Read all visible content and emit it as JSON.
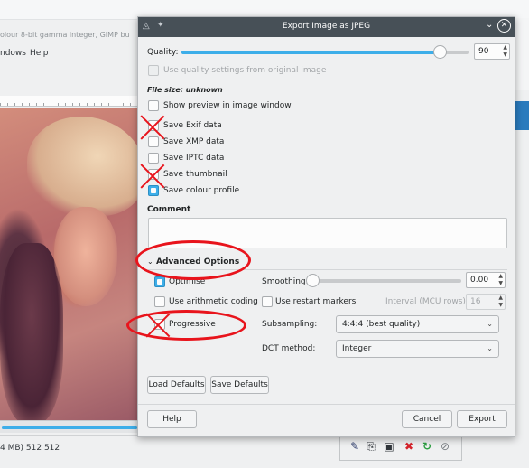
{
  "background_window": {
    "title_fragment": "olour 8-bit gamma integer, GIMP bu",
    "menu_windows": "ndows",
    "menu_help": "Help",
    "status_text": "4 MB) 512 512"
  },
  "dialog": {
    "title": "Export Image as JPEG",
    "quality": {
      "label": "Quality:",
      "value": "90",
      "fraction": 0.9
    },
    "use_original_quality": {
      "label": "Use quality settings from original image",
      "checked": false,
      "enabled": false
    },
    "file_size": "File size: unknown",
    "options": [
      {
        "key": "show_preview",
        "label": "Show preview in image window",
        "checked": false
      },
      {
        "key": "save_exif",
        "label": "Save Exif data",
        "checked": false
      },
      {
        "key": "save_xmp",
        "label": "Save XMP data",
        "checked": false
      },
      {
        "key": "save_iptc",
        "label": "Save IPTC data",
        "checked": false
      },
      {
        "key": "save_thumbnail",
        "label": "Save thumbnail",
        "checked": false
      },
      {
        "key": "save_colour_profile",
        "label": "Save colour profile",
        "checked": true
      }
    ],
    "comment_label": "Comment",
    "comment_value": "",
    "advanced": {
      "label": "Advanced Options",
      "expanded": true,
      "optimise": {
        "label": "Optimise",
        "checked": true
      },
      "arithmetic": {
        "label": "Use arithmetic coding",
        "checked": false
      },
      "progressive": {
        "label": "Progressive",
        "checked": false
      },
      "smoothing": {
        "label": "Smoothing:",
        "value": "0.00",
        "fraction": 0.0
      },
      "restart_markers": {
        "label": "Use restart markers",
        "checked": false
      },
      "interval": {
        "label": "Interval (MCU rows):",
        "value": "16"
      },
      "subsampling": {
        "label": "Subsampling:",
        "value": "4:4:4 (best quality)"
      },
      "dct": {
        "label": "DCT method:",
        "value": "Integer"
      }
    },
    "buttons": {
      "load_defaults": "Load Defaults",
      "save_defaults": "Save Defaults",
      "help": "Help",
      "cancel": "Cancel",
      "export": "Export"
    }
  },
  "colors": {
    "accent": "#3daee9",
    "titlebar": "#475057",
    "annotation": "#e8141c"
  }
}
